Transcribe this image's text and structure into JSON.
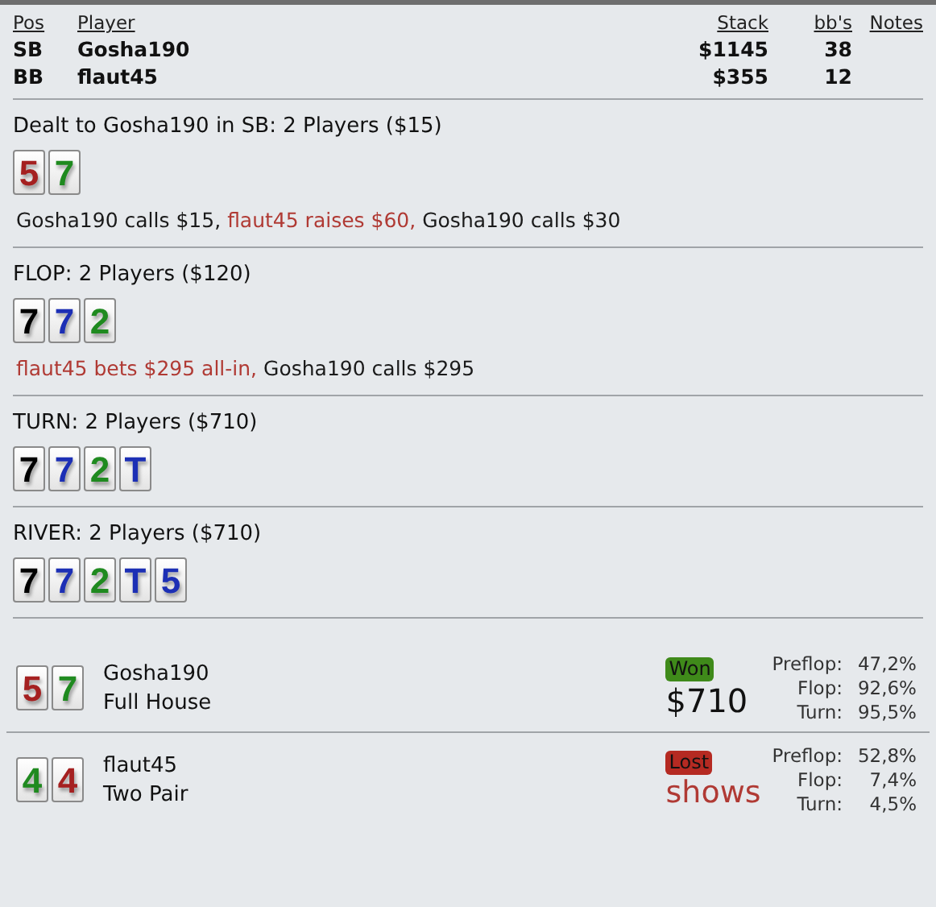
{
  "players_table": {
    "columns": [
      "Pos",
      "Player",
      "Stack",
      "bb's",
      "Notes"
    ],
    "rows": [
      {
        "pos": "SB",
        "player": "Gosha190",
        "stack": "$1145",
        "bbs": "38"
      },
      {
        "pos": "BB",
        "player": "flaut45",
        "stack": "$355",
        "bbs": "12"
      }
    ]
  },
  "streets": [
    {
      "title": "Dealt to Gosha190 in SB: 2 Players ($15)",
      "cards": [
        {
          "rank": "5",
          "color": "#a52020"
        },
        {
          "rank": "7",
          "color": "#1f8a1f"
        }
      ],
      "actions": [
        {
          "text": "Gosha190 calls $15,",
          "kind": "hero"
        },
        {
          "text": "flaut45 raises $60,",
          "kind": "opponent"
        },
        {
          "text": "Gosha190 calls $30",
          "kind": "hero"
        }
      ]
    },
    {
      "title": "FLOP: 2 Players ($120)",
      "cards": [
        {
          "rank": "7",
          "color": "#000000"
        },
        {
          "rank": "7",
          "color": "#1c2fb5"
        },
        {
          "rank": "2",
          "color": "#1f8a1f"
        }
      ],
      "actions": [
        {
          "text": "flaut45 bets $295 all-in,",
          "kind": "opponent"
        },
        {
          "text": "Gosha190 calls $295",
          "kind": "hero"
        }
      ]
    },
    {
      "title": "TURN: 2 Players ($710)",
      "cards": [
        {
          "rank": "7",
          "color": "#000000"
        },
        {
          "rank": "7",
          "color": "#1c2fb5"
        },
        {
          "rank": "2",
          "color": "#1f8a1f"
        },
        {
          "rank": "T",
          "color": "#1c2fb5"
        }
      ]
    },
    {
      "title": "RIVER: 2 Players ($710)",
      "cards": [
        {
          "rank": "7",
          "color": "#000000"
        },
        {
          "rank": "7",
          "color": "#1c2fb5"
        },
        {
          "rank": "2",
          "color": "#1f8a1f"
        },
        {
          "rank": "T",
          "color": "#1c2fb5"
        },
        {
          "rank": "5",
          "color": "#1c2fb5"
        }
      ]
    }
  ],
  "results": [
    {
      "cards": [
        {
          "rank": "5",
          "color": "#a52020"
        },
        {
          "rank": "7",
          "color": "#1f8a1f"
        }
      ],
      "player": "Gosha190",
      "hand": "Full House",
      "kind": "won",
      "badge": "Won",
      "outcome": "$710",
      "equity": [
        {
          "label": "Preflop:",
          "value": "47,2%"
        },
        {
          "label": "Flop:",
          "value": "92,6%"
        },
        {
          "label": "Turn:",
          "value": "95,5%"
        }
      ]
    },
    {
      "cards": [
        {
          "rank": "4",
          "color": "#1f8a1f"
        },
        {
          "rank": "4",
          "color": "#a52020"
        }
      ],
      "player": "flaut45",
      "hand": "Two Pair",
      "kind": "lost",
      "badge": "Lost",
      "outcome": "shows",
      "equity": [
        {
          "label": "Preflop:",
          "value": "52,8%"
        },
        {
          "label": "Flop:",
          "value": "7,4%"
        },
        {
          "label": "Turn:",
          "value": "4,5%"
        }
      ]
    }
  ]
}
